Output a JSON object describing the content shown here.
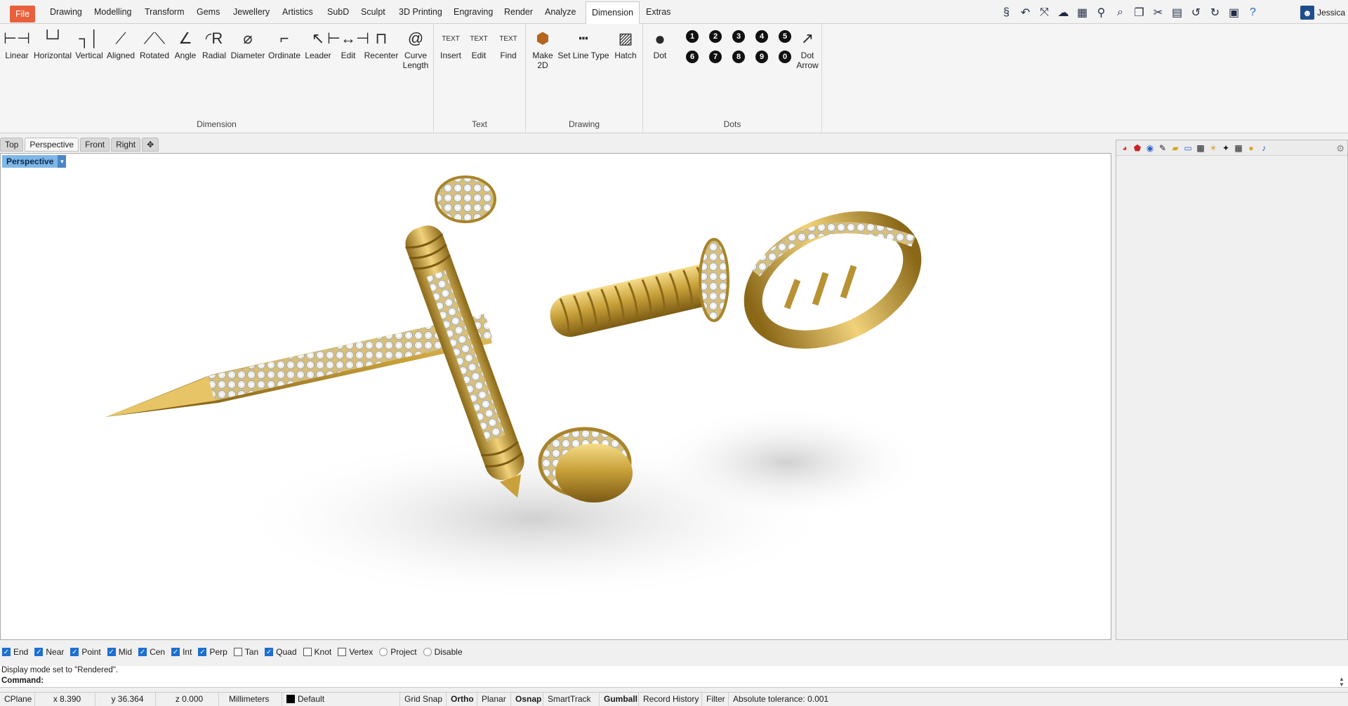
{
  "menu": {
    "tabs": [
      "File",
      "Drawing",
      "Modelling",
      "Transform",
      "Gems",
      "Jewellery",
      "Artistics",
      "SubD",
      "Sculpt",
      "3D Printing",
      "Engraving",
      "Render",
      "Analyze",
      "Dimension",
      "Extras"
    ],
    "active_tab": "Dimension",
    "user": "Jessica"
  },
  "quick_toolbar": [
    "logo-icon",
    "curve-icon",
    "transform-icon",
    "cloud-icon",
    "render-icon",
    "microphone-icon",
    "zoom-icon",
    "copy-icon",
    "cut-icon",
    "paste-icon",
    "undo-icon",
    "redo-icon",
    "save-icon",
    "help-icon"
  ],
  "ribbon": {
    "groups": [
      {
        "label": "Dimension",
        "tools": [
          "Linear",
          "Horizontal",
          "Vertical",
          "Aligned",
          "Rotated",
          "Angle",
          "Radial",
          "Diameter",
          "Ordinate",
          "Leader",
          "Edit",
          "Recenter",
          "Curve\nLength"
        ]
      },
      {
        "label": "Text",
        "tools": [
          "Insert",
          "Edit",
          "Find"
        ]
      },
      {
        "label": "Drawing",
        "tools": [
          "Make\n2D",
          "Set Line Type",
          "Hatch"
        ]
      },
      {
        "label": "Dots",
        "tools": [
          "Dot",
          "Dot\nArrow"
        ],
        "numbers": [
          "1",
          "2",
          "3",
          "4",
          "5",
          "6",
          "7",
          "8",
          "9",
          "0"
        ]
      }
    ],
    "text_tool_captions": [
      "TEXT",
      "TEXT",
      "TEXT"
    ]
  },
  "viewport_tabs": [
    "Top",
    "Perspective",
    "Front",
    "Right"
  ],
  "viewport_active": "Perspective",
  "viewport_title": "Perspective",
  "osnaps": [
    {
      "label": "End",
      "checked": true
    },
    {
      "label": "Near",
      "checked": true
    },
    {
      "label": "Point",
      "checked": true
    },
    {
      "label": "Mid",
      "checked": true
    },
    {
      "label": "Cen",
      "checked": true
    },
    {
      "label": "Int",
      "checked": true
    },
    {
      "label": "Perp",
      "checked": true
    },
    {
      "label": "Tan",
      "checked": false
    },
    {
      "label": "Quad",
      "checked": true
    },
    {
      "label": "Knot",
      "checked": false
    },
    {
      "label": "Vertex",
      "checked": false
    },
    {
      "label": "Project",
      "checked": false
    },
    {
      "label": "Disable",
      "checked": false
    }
  ],
  "command": {
    "history": "Display mode set to \"Rendered\".",
    "prompt": "Command:"
  },
  "status": {
    "cplane": "CPlane",
    "x": "x 8.390",
    "y": "y 36.364",
    "z": "z 0.000",
    "units": "Millimeters",
    "layer": "Default",
    "toggles": [
      "Grid Snap",
      "Ortho",
      "Planar",
      "Osnap",
      "SmartTrack",
      "Gumball",
      "Record History",
      "Filter"
    ],
    "bold_toggles": [
      "Ortho",
      "Osnap",
      "Gumball"
    ],
    "tolerance": "Absolute tolerance: 0.001"
  },
  "colors": {
    "file_tab": "#e8603c",
    "viewport_label": "#7fb7e6",
    "checkbox_on": "#1e6fd0",
    "gold": "#c9a13a"
  }
}
